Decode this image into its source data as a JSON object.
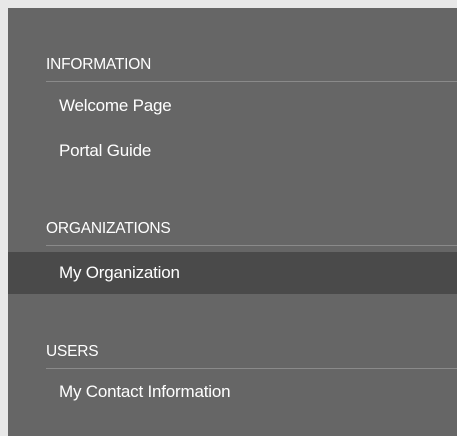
{
  "sidebar": {
    "sections": [
      {
        "title": "INFORMATION",
        "items": [
          {
            "label": "Welcome Page"
          },
          {
            "label": "Portal Guide"
          }
        ]
      },
      {
        "title": "ORGANIZATIONS",
        "items": [
          {
            "label": "My Organization",
            "active": true
          }
        ]
      },
      {
        "title": "USERS",
        "items": [
          {
            "label": "My Contact Information"
          }
        ]
      }
    ]
  },
  "colors": {
    "panel_bg": "#666666",
    "active_bg": "#4a4a4a",
    "divider": "#8a8a8a",
    "text": "#ffffff",
    "outer_bg": "#e8e8e8"
  }
}
